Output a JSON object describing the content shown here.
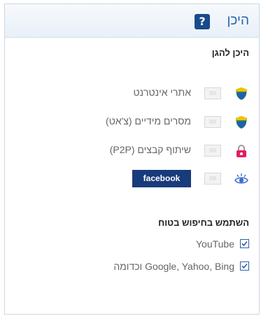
{
  "header": {
    "title": "היכן",
    "help_label": "?"
  },
  "where_to_protect": {
    "title": "היכן להגן",
    "items": [
      {
        "label": "אתרי אינטרנט",
        "icon": "shield-icon",
        "status_color": "#2f8f3f"
      },
      {
        "label": "מסרים מידיים (צ'אט)",
        "icon": "shield-icon",
        "status_color": "#2f8f3f"
      },
      {
        "label": "שיתוף קבצים (P2P)",
        "icon": "lock-icon",
        "status_color": "#e01f63"
      },
      {
        "label": "facebook",
        "icon": "eye-icon",
        "status_color": "#3b6fd0"
      }
    ]
  },
  "safe_search": {
    "title": "השתמש בחיפוש בטוח",
    "items": [
      {
        "label": "YouTube",
        "checked": true
      },
      {
        "label": "Google, Yahoo, Bing וכדומה",
        "checked": true
      }
    ]
  }
}
